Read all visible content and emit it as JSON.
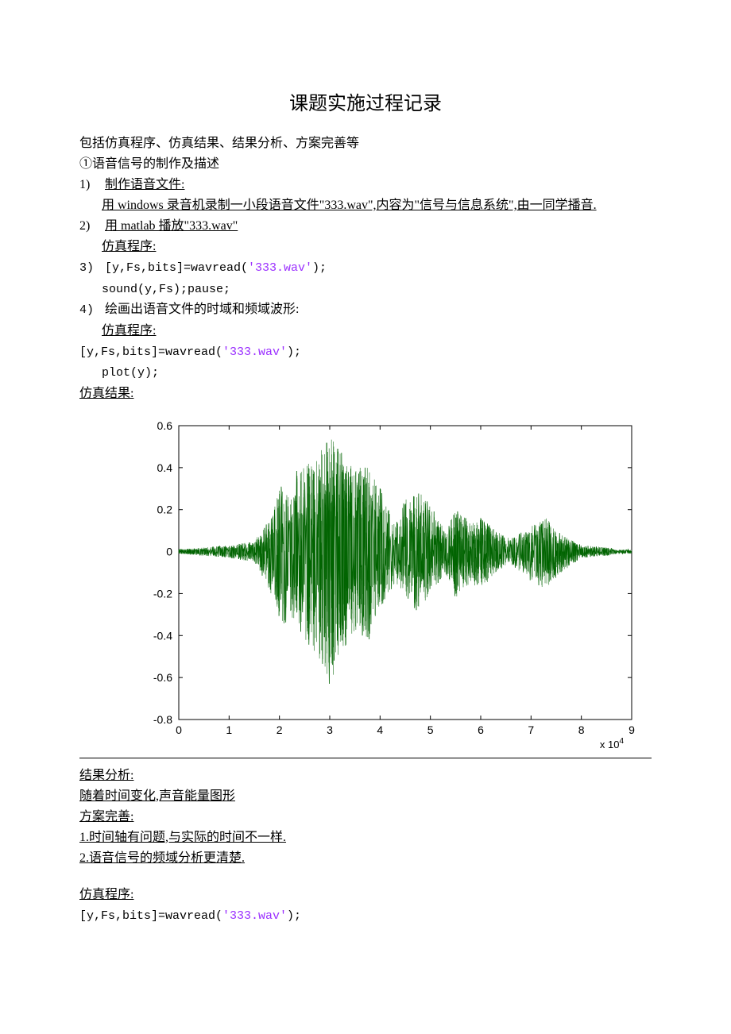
{
  "title": "课题实施过程记录",
  "intro": {
    "line1": "包括仿真程序、仿真结果、结果分析、方案完善等",
    "line2": "①语音信号的制作及描述"
  },
  "items": {
    "n1": "1)",
    "n2": "2)",
    "n3": "3)",
    "n4": "4)",
    "t1a": "制作语音文件:",
    "t1b": "用 windows 录音机录制一小段语音文件\"333.wav\",内容为\"信号与信息系统\",由一同学播音.",
    "t2a": "用 matlab 播放\"333.wav\"",
    "t2b": "仿真程序:",
    "t3a": " [y,Fs,bits]=wavread(",
    "t3s": "'333.wav'",
    "t3b": ");",
    "t3c": "sound(y,Fs);pause;",
    "t4a": "绘画出语音文件的时域和频域波形:",
    "t4b": "仿真程序:",
    "code4a": "[y,Fs,bits]=wavread(",
    "code4s": "'333.wav'",
    "code4b": ");",
    "code4c": "plot(y);"
  },
  "simresult_label": "仿真结果:",
  "analysis": {
    "h1": "结果分析:",
    "a1": "随着时间变化,声音能量图形",
    "h2": "方案完善:",
    "p1": "1.时间轴有问题,与实际的时间不一样.",
    "p2": "2.语音信号的频域分析更清楚."
  },
  "bottom": {
    "h": "仿真程序:",
    "c1a": "[y,Fs,bits]=wavread(",
    "c1s": "'333.wav'",
    "c1b": ");"
  },
  "chart_data": {
    "type": "line",
    "title": "",
    "xlabel": "",
    "ylabel": "",
    "xlim": [
      0,
      90000
    ],
    "ylim": [
      -0.8,
      0.6
    ],
    "xticks": [
      0,
      10000,
      20000,
      30000,
      40000,
      50000,
      60000,
      70000,
      80000,
      90000
    ],
    "xtick_labels": [
      "0",
      "1",
      "2",
      "3",
      "4",
      "5",
      "6",
      "7",
      "8",
      "9"
    ],
    "x_exponent_label": "x 10^4",
    "yticks": [
      -0.8,
      -0.6,
      -0.4,
      -0.2,
      0,
      0.2,
      0.4,
      0.6
    ],
    "envelope": [
      {
        "x": 0,
        "lo": -0.01,
        "hi": 0.01
      },
      {
        "x": 5000,
        "lo": -0.02,
        "hi": 0.02
      },
      {
        "x": 10000,
        "lo": -0.03,
        "hi": 0.03
      },
      {
        "x": 15000,
        "lo": -0.05,
        "hi": 0.05
      },
      {
        "x": 18000,
        "lo": -0.18,
        "hi": 0.15
      },
      {
        "x": 20000,
        "lo": -0.35,
        "hi": 0.3
      },
      {
        "x": 23000,
        "lo": -0.32,
        "hi": 0.38
      },
      {
        "x": 25000,
        "lo": -0.42,
        "hi": 0.4
      },
      {
        "x": 27000,
        "lo": -0.48,
        "hi": 0.45
      },
      {
        "x": 29000,
        "lo": -0.55,
        "hi": 0.5
      },
      {
        "x": 30000,
        "lo": -0.65,
        "hi": 0.55
      },
      {
        "x": 32000,
        "lo": -0.5,
        "hi": 0.48
      },
      {
        "x": 35000,
        "lo": -0.38,
        "hi": 0.4
      },
      {
        "x": 38000,
        "lo": -0.42,
        "hi": 0.4
      },
      {
        "x": 40000,
        "lo": -0.28,
        "hi": 0.3
      },
      {
        "x": 43000,
        "lo": -0.15,
        "hi": 0.12
      },
      {
        "x": 45000,
        "lo": -0.22,
        "hi": 0.25
      },
      {
        "x": 48000,
        "lo": -0.3,
        "hi": 0.28
      },
      {
        "x": 50000,
        "lo": -0.2,
        "hi": 0.22
      },
      {
        "x": 53000,
        "lo": -0.1,
        "hi": 0.1
      },
      {
        "x": 55000,
        "lo": -0.22,
        "hi": 0.2
      },
      {
        "x": 58000,
        "lo": -0.15,
        "hi": 0.14
      },
      {
        "x": 60000,
        "lo": -0.18,
        "hi": 0.16
      },
      {
        "x": 63000,
        "lo": -0.1,
        "hi": 0.1
      },
      {
        "x": 66000,
        "lo": -0.06,
        "hi": 0.06
      },
      {
        "x": 70000,
        "lo": -0.14,
        "hi": 0.12
      },
      {
        "x": 73000,
        "lo": -0.18,
        "hi": 0.16
      },
      {
        "x": 76000,
        "lo": -0.1,
        "hi": 0.08
      },
      {
        "x": 80000,
        "lo": -0.03,
        "hi": 0.03
      },
      {
        "x": 85000,
        "lo": -0.02,
        "hi": 0.02
      },
      {
        "x": 87000,
        "lo": -0.01,
        "hi": 0.01
      }
    ]
  }
}
